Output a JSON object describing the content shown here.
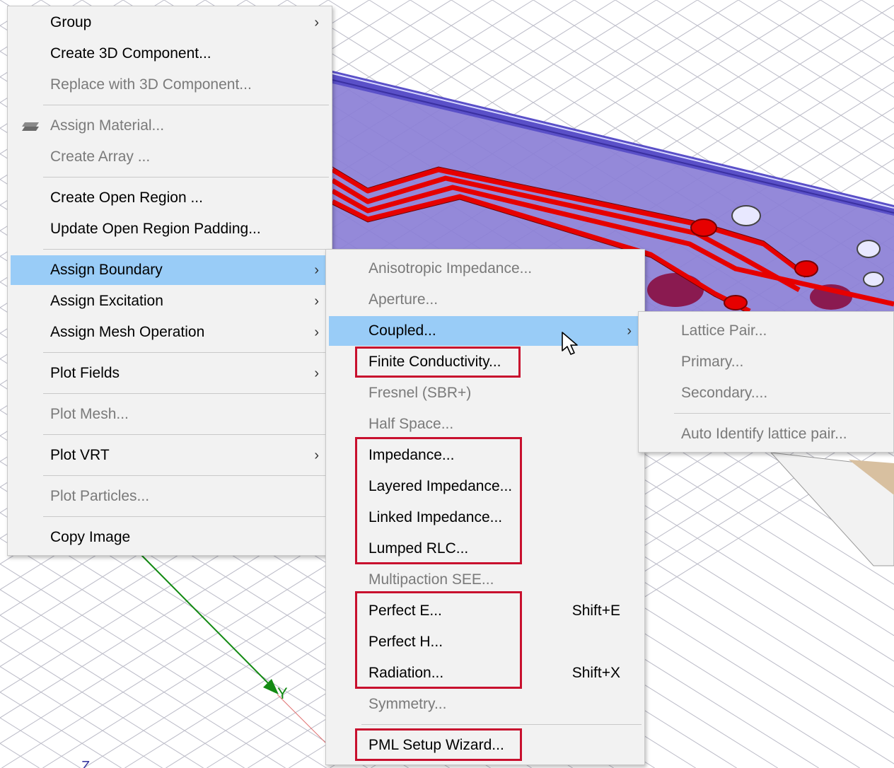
{
  "viewport": {
    "axis_label_y": "Y",
    "axis_label_z": "Z",
    "colors": {
      "board": "#8b7fd6",
      "trace": "#e60000",
      "grid": "#bcbcc8",
      "axis_green": "#138a13",
      "axis_red": "#e07070"
    }
  },
  "main_menu": {
    "items": [
      {
        "label": "Group",
        "has_submenu": true,
        "enabled": true
      },
      {
        "label": "Create 3D Component...",
        "has_submenu": false,
        "enabled": true
      },
      {
        "label": "Replace with 3D Component...",
        "has_submenu": false,
        "enabled": false
      },
      {
        "label": "Assign Material...",
        "has_submenu": false,
        "enabled": false,
        "icon": "layers-icon"
      },
      {
        "label": "Create Array ...",
        "has_submenu": false,
        "enabled": false
      },
      {
        "label": "Create Open Region ...",
        "has_submenu": false,
        "enabled": true
      },
      {
        "label": "Update Open Region Padding...",
        "has_submenu": false,
        "enabled": true
      },
      {
        "label": "Assign Boundary",
        "has_submenu": true,
        "enabled": true,
        "highlighted": true
      },
      {
        "label": "Assign Excitation",
        "has_submenu": true,
        "enabled": true
      },
      {
        "label": "Assign Mesh Operation",
        "has_submenu": true,
        "enabled": true
      },
      {
        "label": "Plot Fields",
        "has_submenu": true,
        "enabled": true
      },
      {
        "label": "Plot Mesh...",
        "has_submenu": false,
        "enabled": false
      },
      {
        "label": "Plot VRT",
        "has_submenu": true,
        "enabled": true
      },
      {
        "label": "Plot Particles...",
        "has_submenu": false,
        "enabled": false
      },
      {
        "label": "Copy Image",
        "has_submenu": false,
        "enabled": true
      }
    ],
    "arrow_glyph": "›"
  },
  "boundary_menu": {
    "items": [
      {
        "label": "Anisotropic Impedance...",
        "enabled": false
      },
      {
        "label": "Aperture...",
        "enabled": false
      },
      {
        "label": "Coupled...",
        "enabled": true,
        "highlighted": true,
        "has_submenu": true
      },
      {
        "label": "Finite Conductivity...",
        "enabled": true,
        "boxed": true
      },
      {
        "label": "Fresnel (SBR+)",
        "enabled": false
      },
      {
        "label": "Half Space...",
        "enabled": false
      },
      {
        "label": "Impedance...",
        "enabled": true,
        "boxed": true
      },
      {
        "label": "Layered Impedance...",
        "enabled": true,
        "boxed": true
      },
      {
        "label": "Linked Impedance...",
        "enabled": true,
        "boxed": true
      },
      {
        "label": "Lumped RLC...",
        "enabled": true,
        "boxed": true
      },
      {
        "label": "Multipaction SEE...",
        "enabled": false
      },
      {
        "label": "Perfect E...",
        "enabled": true,
        "boxed": true,
        "shortcut": "Shift+E"
      },
      {
        "label": "Perfect H...",
        "enabled": true,
        "boxed": true
      },
      {
        "label": "Radiation...",
        "enabled": true,
        "boxed": true,
        "shortcut": "Shift+X"
      },
      {
        "label": "Symmetry...",
        "enabled": false
      },
      {
        "label": "PML Setup Wizard...",
        "enabled": true,
        "boxed": true
      }
    ]
  },
  "coupled_menu": {
    "items": [
      {
        "label": "Lattice Pair...",
        "enabled": false
      },
      {
        "label": "Primary...",
        "enabled": false
      },
      {
        "label": "Secondary....",
        "enabled": false
      },
      {
        "label": "Auto Identify lattice pair...",
        "enabled": false
      }
    ]
  },
  "highlight_color": "#c8102e"
}
